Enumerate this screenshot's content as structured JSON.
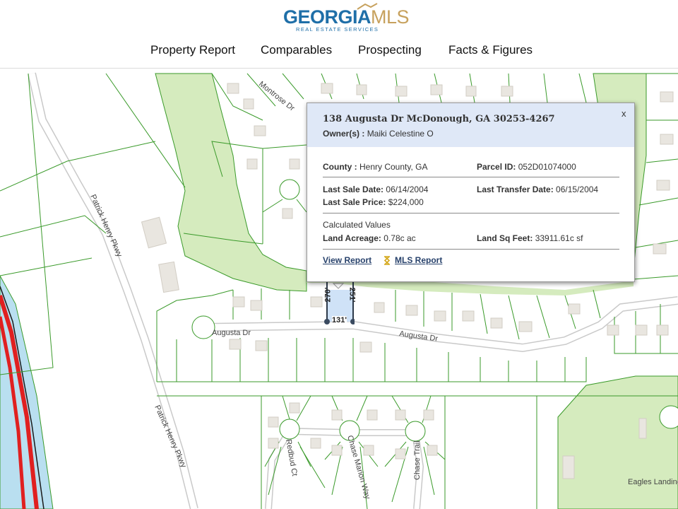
{
  "header": {
    "logo_brand": "GEORGIA",
    "logo_brand_suffix": "MLS",
    "logo_tagline": "REAL ESTATE SERVICES",
    "nav": [
      "Property Report",
      "Comparables",
      "Prospecting",
      "Facts & Figures"
    ],
    "colors": {
      "brand_blue": "#1f6fa8",
      "brand_gold": "#c7a15d"
    }
  },
  "map": {
    "road_labels": {
      "montrose": "Montrose Dr",
      "patrick1": "Patrick Henry Pkwy",
      "patrick2": "Patrick Henry Pkwy",
      "augusta1": "Augusta Dr",
      "augusta2": "Augusta Dr",
      "redbud": "Redbud Ct",
      "chasemarion": "Chase Marion Way",
      "chasetrail": "Chase Trail",
      "eagles": "Eagles Landing"
    },
    "dimensions": {
      "left": "270'",
      "right": "251'",
      "bottom": "131'"
    },
    "colors": {
      "parcel_line": "#3a9a2a",
      "greenspace": "#d5ebbe",
      "highway": "#e02020",
      "selected_parcel": "#cfe2f7"
    }
  },
  "popup": {
    "address": "138 Augusta Dr McDonough, GA 30253-4267",
    "owner_label": "Owner(s) :",
    "owner_value": "Maiki Celestine O",
    "close": "x",
    "county_label": "County :",
    "county_value": "Henry County, GA",
    "parcel_label": "Parcel ID:",
    "parcel_value": "052D01074000",
    "last_sale_date_label": "Last Sale Date:",
    "last_sale_date_value": "06/14/2004",
    "last_transfer_label": "Last Transfer Date:",
    "last_transfer_value": "06/15/2004",
    "last_sale_price_label": "Last Sale Price:",
    "last_sale_price_value": "$224,000",
    "calc_heading": "Calculated Values",
    "acreage_label": "Land Acreage:",
    "acreage_value": "0.78c ac",
    "sqft_label": "Land Sq Feet:",
    "sqft_value": "33911.61c sf",
    "view_report": "View Report",
    "mls_report": "MLS Report"
  }
}
